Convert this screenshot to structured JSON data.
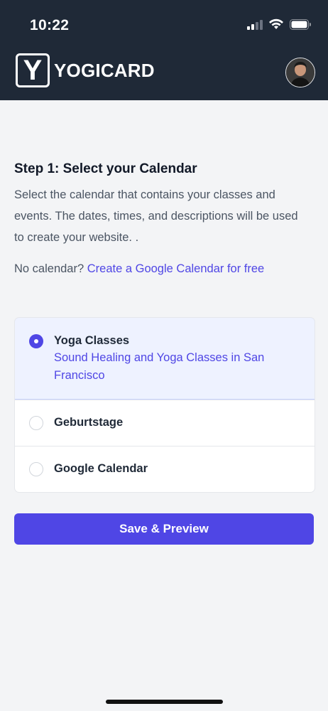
{
  "status_bar": {
    "time": "10:22"
  },
  "header": {
    "logo_letter": "Y",
    "logo_text": "YOGICARD",
    "avatar_icon": "user-avatar"
  },
  "main": {
    "step_title": "Step 1: Select your Calendar",
    "description": "Select the calendar that contains your classes and events. The dates, times, and descriptions will be used to create your website. .",
    "no_calendar_text": "No calendar?",
    "no_calendar_link": "Create a Google Calendar for free",
    "calendars": [
      {
        "label": "Yoga Classes",
        "description": "Sound Healing and Yoga Classes in San Francisco",
        "selected": true
      },
      {
        "label": "Geburtstage",
        "selected": false
      },
      {
        "label": "Google Calendar",
        "selected": false
      }
    ],
    "save_button": "Save & Preview"
  },
  "colors": {
    "header_bg": "#1f2937",
    "accent": "#4f46e5",
    "page_bg": "#f3f4f6"
  }
}
